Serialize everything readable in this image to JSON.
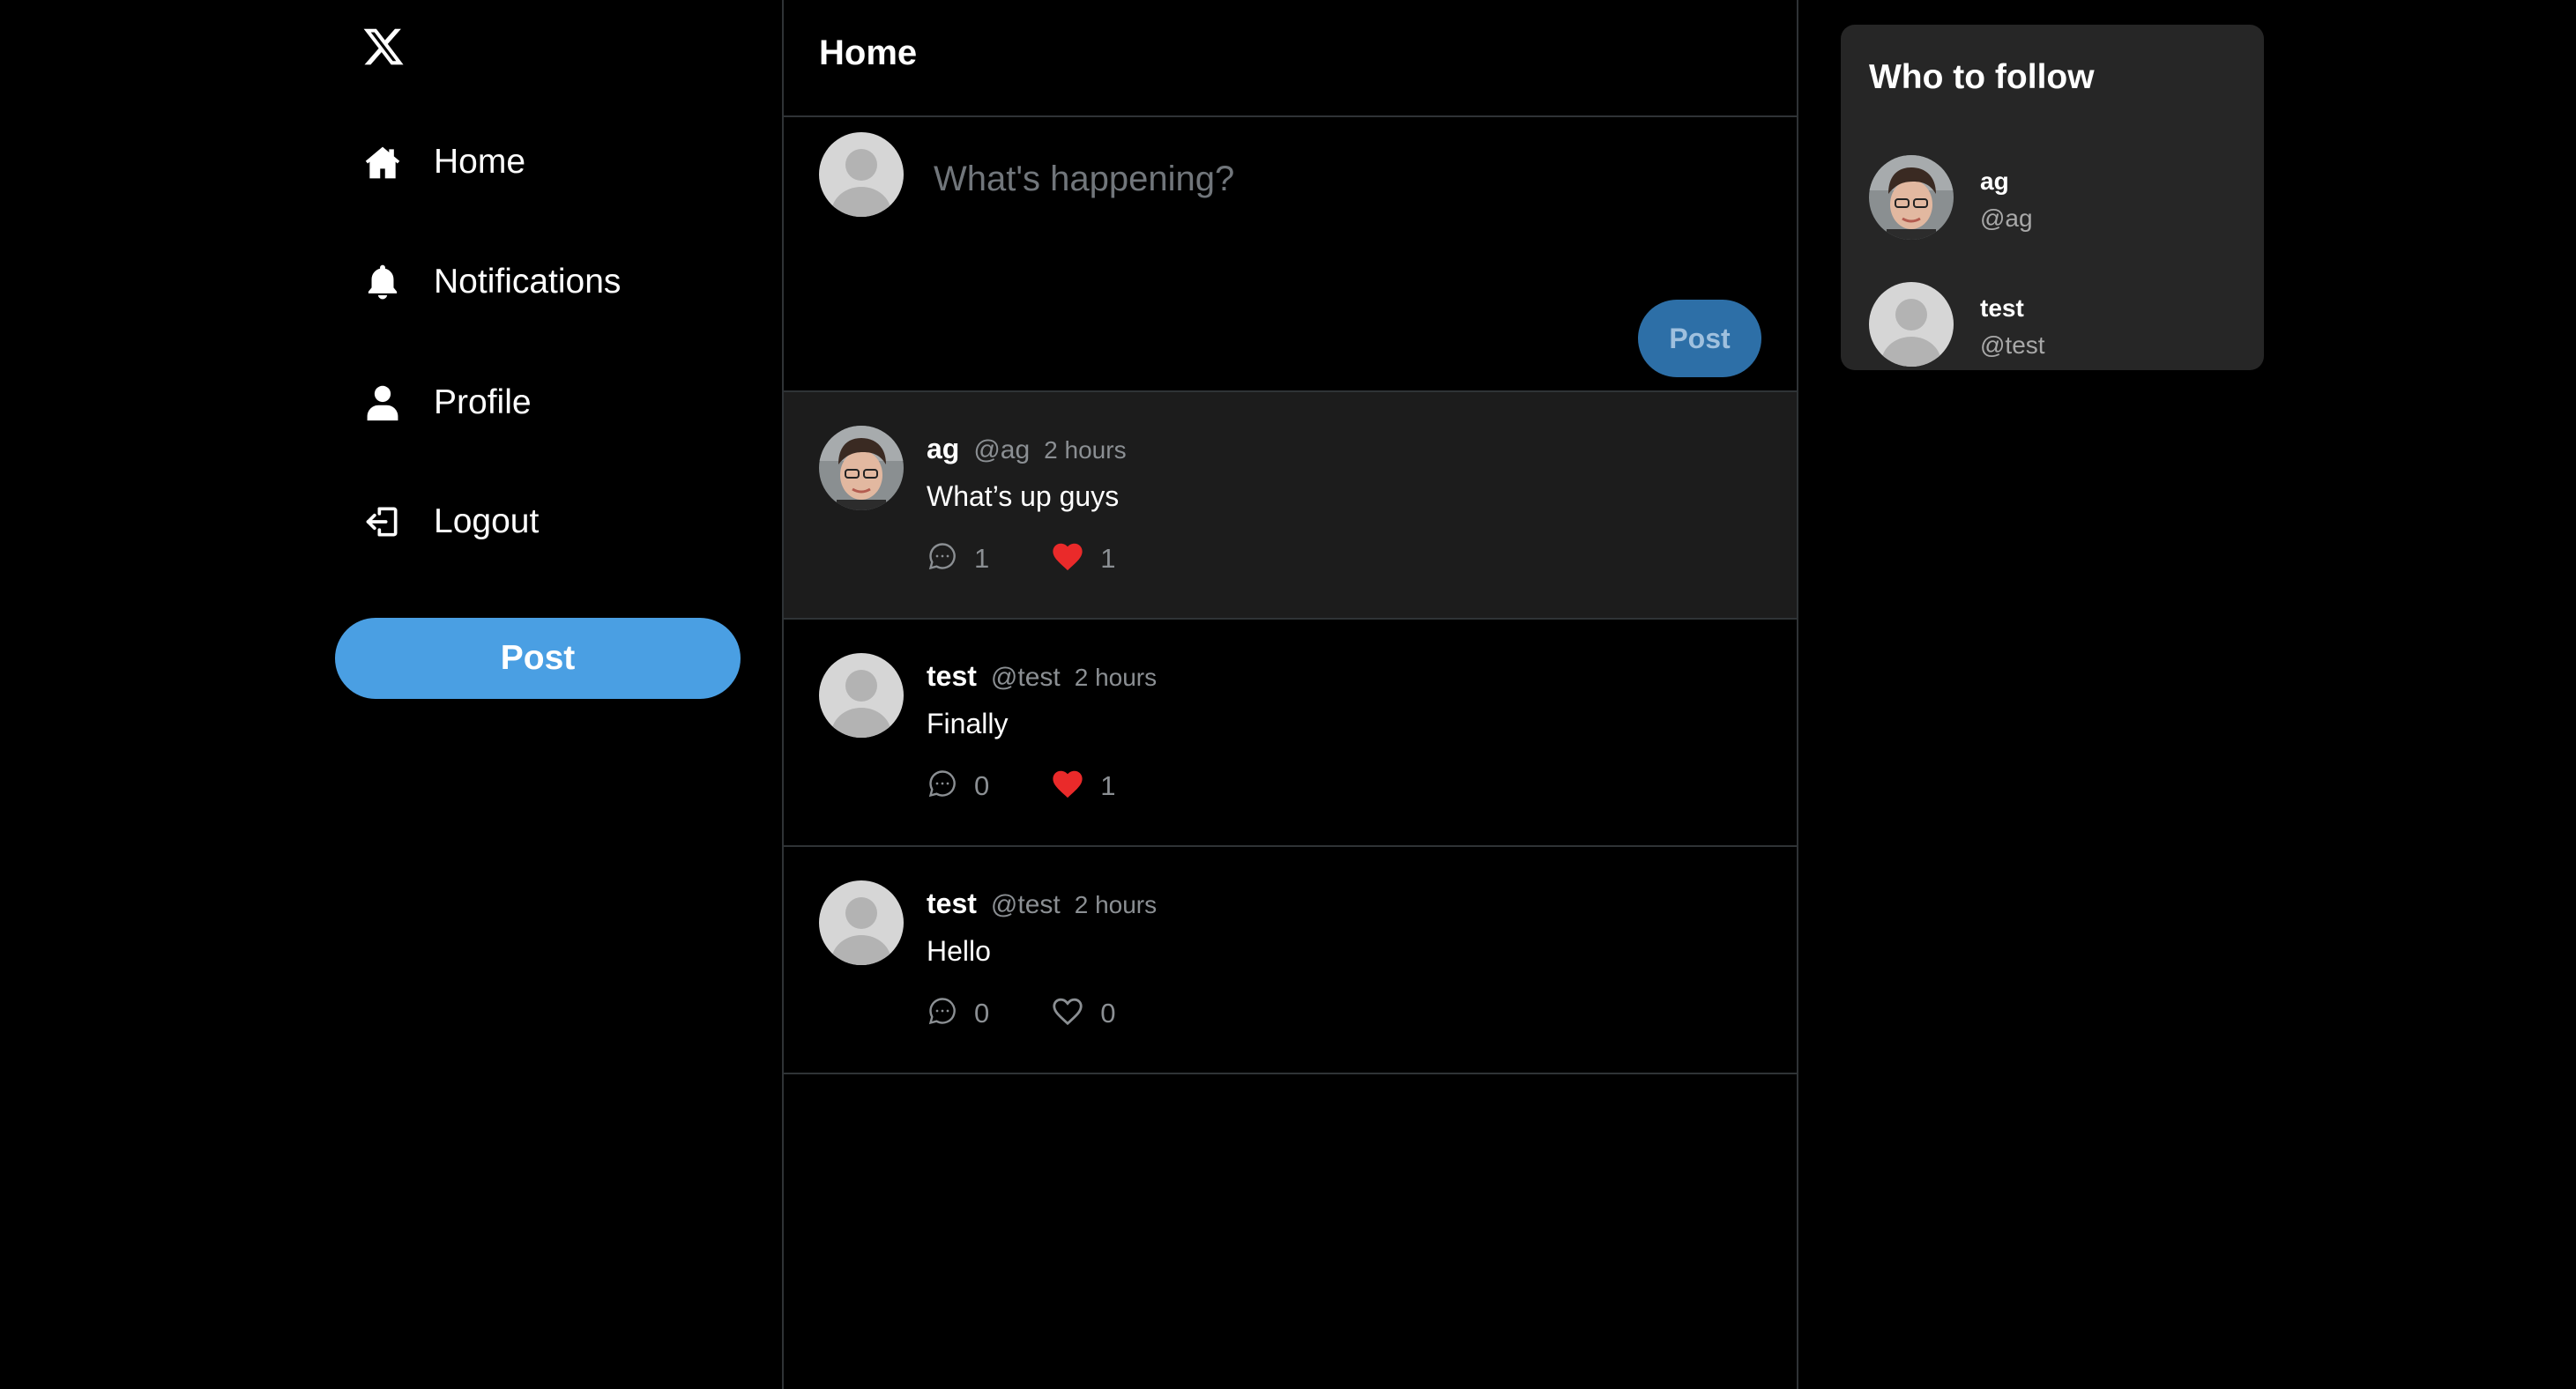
{
  "sidebar": {
    "logo": "x-logo-icon",
    "items": [
      {
        "label": "Home",
        "icon": "house-icon"
      },
      {
        "label": "Notifications",
        "icon": "bell-icon"
      },
      {
        "label": "Profile",
        "icon": "user-icon"
      },
      {
        "label": "Logout",
        "icon": "logout-icon"
      }
    ],
    "post_label": "Post"
  },
  "main": {
    "title": "Home",
    "composer": {
      "placeholder": "What's happening?",
      "post_label": "Post"
    },
    "posts": [
      {
        "name": "ag",
        "handle": "@ag",
        "time": "2 hours",
        "text": "What’s up guys",
        "comments": "1",
        "likes": "1",
        "liked": true,
        "avatar": "photo"
      },
      {
        "name": "test",
        "handle": "@test",
        "time": "2 hours",
        "text": "Finally",
        "comments": "0",
        "likes": "1",
        "liked": true,
        "avatar": "default"
      },
      {
        "name": "test",
        "handle": "@test",
        "time": "2 hours",
        "text": "Hello",
        "comments": "0",
        "likes": "0",
        "liked": false,
        "avatar": "default"
      }
    ]
  },
  "right": {
    "who_to_follow": {
      "title": "Who to follow",
      "users": [
        {
          "name": "ag",
          "handle": "@ag",
          "avatar": "photo"
        },
        {
          "name": "test",
          "handle": "@test",
          "avatar": "default"
        }
      ]
    }
  },
  "colors": {
    "background": "#000000",
    "accent": "#4a9fe3",
    "like": "#f91880",
    "muted": "#8b8f93",
    "card": "#262626"
  }
}
